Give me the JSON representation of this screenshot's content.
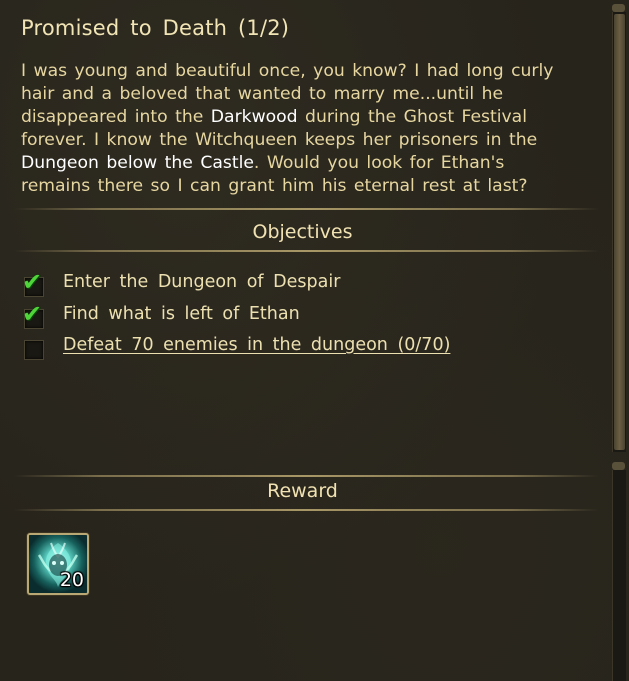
{
  "quest": {
    "title": "Promised to Death (1/2)",
    "description": {
      "part1": "I was young and beautiful once, you know? I had long curly hair and a beloved that wanted to marry me...until he disappeared into the ",
      "place1": "Darkwood",
      "part2": " during the Ghost Festival forever. I know the Witchqueen keeps her prisoners in the ",
      "place2": "Dungeon below the Castle",
      "part3": ". Would you look for Ethan's remains there so I can grant him his eternal rest at last?"
    }
  },
  "objectives": {
    "heading": "Objectives",
    "items": [
      {
        "label": "Enter the Dungeon of Despair",
        "completed": true
      },
      {
        "label": "Find what is left of Ethan",
        "completed": true
      },
      {
        "label": "Defeat 70 enemies in the dungeon (0/70)",
        "completed": false
      }
    ]
  },
  "reward": {
    "heading": "Reward",
    "items": [
      {
        "icon": "ghost-essence-icon",
        "count": "20"
      }
    ]
  },
  "colors": {
    "background": "#27241c",
    "text": "#e6d6a0",
    "highlight": "#ffffff",
    "check": "#4fd43a"
  }
}
